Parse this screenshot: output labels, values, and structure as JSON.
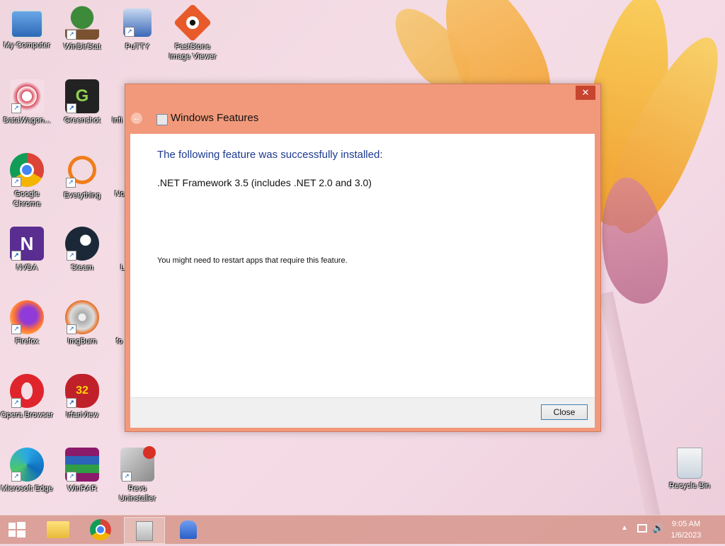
{
  "desktop": {
    "icons": [
      {
        "label": "My Computer"
      },
      {
        "label": "WinDirStat"
      },
      {
        "label": "PuTTY"
      },
      {
        "label": "FastStone Image Viewer"
      },
      {
        "label": "DataWagon..."
      },
      {
        "label": "Greenshot"
      },
      {
        "label": "Infi"
      },
      {
        "label": "Google Chrome"
      },
      {
        "label": "Everything"
      },
      {
        "label": "No"
      },
      {
        "label": "NVDA"
      },
      {
        "label": "Steam"
      },
      {
        "label": "L"
      },
      {
        "label": "Firefox"
      },
      {
        "label": "ImgBurn"
      },
      {
        "label": "fo"
      },
      {
        "label": "Opera Browser"
      },
      {
        "label": "IrfanView"
      },
      {
        "label": "Microsoft Edge"
      },
      {
        "label": "WinRAR"
      },
      {
        "label": "Revo Uninstaller"
      },
      {
        "label": "Recycle Bin"
      }
    ]
  },
  "dialog": {
    "title": "Windows Features",
    "close_glyph": "✕",
    "heading": "The following feature was successfully installed:",
    "feature": ".NET Framework 3.5 (includes .NET 2.0 and 3.0)",
    "note": "You might need to restart apps that require this feature.",
    "close_button": "Close"
  },
  "taskbar": {
    "time": "9:05 AM",
    "date": "1/6/2023"
  },
  "colors": {
    "accent": "#f1997a",
    "heading": "#1c3a8f"
  }
}
